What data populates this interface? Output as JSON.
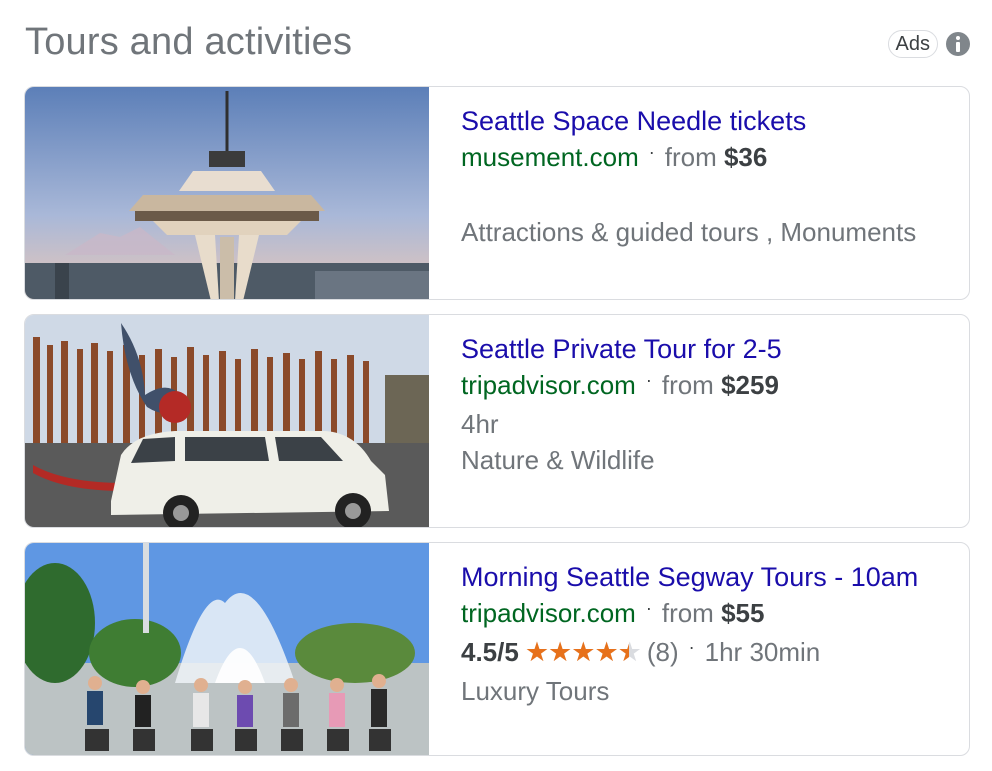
{
  "header": {
    "title": "Tours and activities",
    "ads_label": "Ads",
    "info_icon": "info-icon"
  },
  "colors": {
    "title_link": "#1a0dab",
    "site_url": "#006621",
    "muted": "#70757a",
    "star": "#e7711b"
  },
  "cards": [
    {
      "title": "Seattle Space Needle tickets",
      "site": "musement.com",
      "from_label": "from",
      "price": "$36",
      "duration": "",
      "category": "Attractions & guided tours , Monuments",
      "image": "space-needle-photo"
    },
    {
      "title": "Seattle Private Tour for 2-5",
      "site": "tripadvisor.com",
      "from_label": "from",
      "price": "$259",
      "duration": "4hr",
      "category": "Nature & Wildlife",
      "image": "white-suv-sculpture-photo"
    },
    {
      "title": "Morning Seattle Segway Tours - 10am",
      "site": "tripadvisor.com",
      "from_label": "from",
      "price": "$55",
      "rating": "4.5/5",
      "rating_value": 4.5,
      "stars": "★★★★★",
      "review_count": "(8)",
      "duration": "1hr 30min",
      "category": "Luxury Tours",
      "image": "segway-group-fountain-photo"
    }
  ]
}
